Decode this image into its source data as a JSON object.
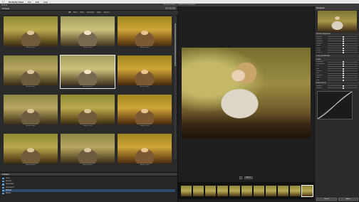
{
  "menubar": {
    "apple": "",
    "app": "Perfectly Clear",
    "items": [
      "File",
      "Edit",
      "Help"
    ],
    "right": ""
  },
  "window": {
    "title": "Perfectly Clear — Perfect Preset Maker"
  },
  "presets": {
    "header": "Presets",
    "tabs": [
      "All",
      "Main",
      "Mine",
      "Favorites",
      "Edits",
      "Recent"
    ],
    "thumbnails": [
      {
        "caption": "Avalon Glow",
        "style": "s1"
      },
      {
        "caption": "Avalon Glow",
        "style": "s2"
      },
      {
        "caption": "Avalon Glow",
        "style": "s3"
      },
      {
        "caption": "Avalon Matte",
        "style": "s4"
      },
      {
        "caption": "Avalon Pastel",
        "style": "s2",
        "selected": true
      },
      {
        "caption": "Avalon Warm",
        "style": "s3"
      },
      {
        "caption": "Avalon Sepia",
        "style": "s4"
      },
      {
        "caption": "Avalon Vivid",
        "style": "s1"
      },
      {
        "caption": "Avalon Vivid",
        "style": "s3"
      },
      {
        "caption": "Avalon Warm",
        "style": "s1"
      },
      {
        "caption": "Avalon Warm",
        "style": "s4"
      },
      {
        "caption": "Avalon Glow",
        "style": "s3"
      }
    ]
  },
  "folders": {
    "header": "Folders",
    "items": [
      {
        "label": "Users",
        "selected": false
      },
      {
        "label": "Desktop",
        "selected": false
      },
      {
        "label": "Downloads",
        "selected": false
      },
      {
        "label": "Documents",
        "selected": false
      },
      {
        "label": "Pictures",
        "selected": true
      },
      {
        "label": "Movies",
        "selected": false
      }
    ]
  },
  "preview": {
    "toggle_label": "Before"
  },
  "filmstrip": {
    "count": 11,
    "selected_index": 10
  },
  "right_panel": {
    "navigator": "Navigator",
    "controls": [
      {
        "title": "Perfect Exposure",
        "sliders": [
          "Exposure",
          "Contrast",
          "Highlights",
          "Shadows",
          "Whites",
          "Blacks",
          "Clarity",
          "Vibrance"
        ]
      },
      {
        "title": "Crop and Rotate",
        "sliders": []
      },
      {
        "title": "Color",
        "sliders": [
          "Saturation",
          "Temperature",
          "Tint",
          "Skin",
          "Vibrance",
          "Hue",
          "Lightness",
          "Depth",
          "Fade"
        ]
      },
      {
        "title": "Tone Curve",
        "sliders": [
          "Highlights",
          "Shadows"
        ]
      }
    ],
    "bottom_buttons": [
      "Cancel",
      "Apply"
    ]
  },
  "colors": {
    "accent": "#2f4a6a",
    "folder": "#5aa2d8"
  }
}
